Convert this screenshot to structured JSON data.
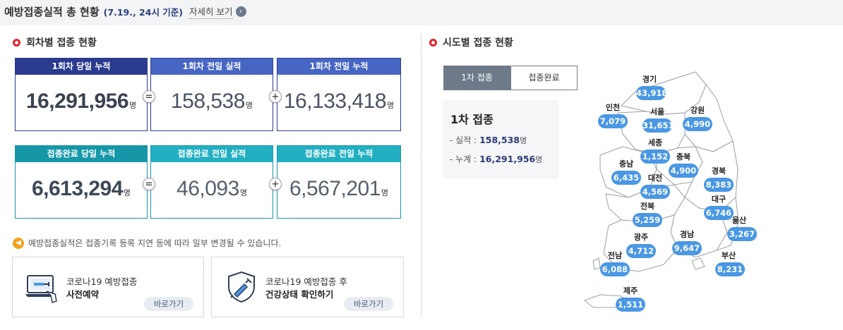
{
  "header": {
    "title": "예방접종실적 총 현황",
    "date": "(7.19., 24시 기준)",
    "more_label": "자세히 보기",
    "more_icon": "chevron-right-icon"
  },
  "round_section": {
    "title": "회차별 접종 현황",
    "first_dose": [
      {
        "caption": "1회차 당일 누적",
        "value": "16,291,956",
        "unit": "명"
      },
      {
        "caption": "1회차 전일 실적",
        "value": "158,538",
        "unit": "명"
      },
      {
        "caption": "1회차 전일 누적",
        "value": "16,133,418",
        "unit": "명"
      }
    ],
    "completed": [
      {
        "caption": "접종완료 당일 누적",
        "value": "6,613,294",
        "unit": "명"
      },
      {
        "caption": "접종완료 전일 실적",
        "value": "46,093",
        "unit": "명"
      },
      {
        "caption": "접종완료 전일 누적",
        "value": "6,567,201",
        "unit": "명"
      }
    ],
    "op_equals": "=",
    "op_plus": "+"
  },
  "notice": {
    "icon": "speaker-icon",
    "text": "예방접종실적은 접종기록 등록 지연 등에 따라 일부 변경될 수 있습니다."
  },
  "links": [
    {
      "line1": "코로나19 예방접종",
      "line2": "사전예약",
      "button": "바로가기",
      "icon": "laptop-syringe-icon"
    },
    {
      "line1": "코로나19 예방접종 후",
      "line2": "건강상태 확인하기",
      "button": "바로가기",
      "icon": "shield-syringe-icon"
    }
  ],
  "region_section": {
    "title": "시도별 접종 현황",
    "tabs": [
      "1차 접종",
      "접종완료"
    ],
    "active_tab": "1차 접종",
    "summary": {
      "title": "1차 접종",
      "rows": [
        {
          "label": "- 실적 :",
          "value": "158,538",
          "unit": "명"
        },
        {
          "label": "- 누계 :",
          "value": "16,291,956",
          "unit": "명"
        }
      ]
    },
    "regions": [
      {
        "name": "경기",
        "value": "43,918"
      },
      {
        "name": "인천",
        "value": "7,079"
      },
      {
        "name": "서울",
        "value": "31,651"
      },
      {
        "name": "강원",
        "value": "4,990"
      },
      {
        "name": "세종",
        "value": "1,152"
      },
      {
        "name": "충남",
        "value": "6,435"
      },
      {
        "name": "충북",
        "value": "4,900"
      },
      {
        "name": "대전",
        "value": "4,569"
      },
      {
        "name": "경북",
        "value": "8,383"
      },
      {
        "name": "대구",
        "value": "6,746"
      },
      {
        "name": "전북",
        "value": "5,259"
      },
      {
        "name": "울산",
        "value": "3,267"
      },
      {
        "name": "광주",
        "value": "4,712"
      },
      {
        "name": "경남",
        "value": "9,647"
      },
      {
        "name": "전남",
        "value": "6,088"
      },
      {
        "name": "부산",
        "value": "8,231"
      },
      {
        "name": "제주",
        "value": "1,511"
      }
    ],
    "colors": {
      "badge": "#4a97e3",
      "map_fill": "#ffffff",
      "map_stroke": "#9aa0a8"
    }
  }
}
